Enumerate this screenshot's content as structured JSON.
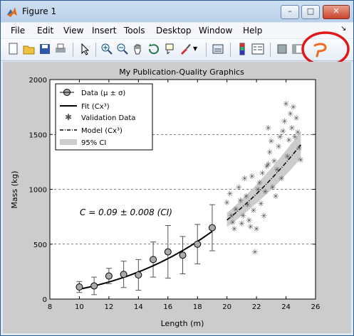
{
  "window": {
    "title": "Figure 1"
  },
  "menu": [
    "File",
    "Edit",
    "View",
    "Insert",
    "Tools",
    "Desktop",
    "Window",
    "Help"
  ],
  "chart_data": {
    "type": "scatter",
    "title": "My Publication-Quality Graphics",
    "xlabel": "Length (m)",
    "ylabel": "Mass (kg)",
    "xlim": [
      8,
      26
    ],
    "ylim": [
      0,
      2000
    ],
    "xticks": [
      8,
      10,
      12,
      14,
      16,
      18,
      20,
      22,
      24,
      26
    ],
    "yticks": [
      0,
      500,
      1000,
      1500,
      2000
    ],
    "grid": "horizontal dashed",
    "legend_position": "top-left",
    "annotation": "C = 0.09 ± 0.008 (CI)",
    "legend": [
      "Data (μ ± σ)",
      "Fit (Cx³)",
      "Validation Data",
      "Model (Cx³)",
      "95% CI"
    ],
    "data": {
      "x": [
        10,
        11,
        12,
        13,
        14,
        15,
        16,
        17,
        18,
        19
      ],
      "y": [
        110,
        120,
        210,
        225,
        220,
        360,
        430,
        400,
        500,
        650
      ],
      "err": [
        50,
        80,
        70,
        120,
        140,
        160,
        240,
        170,
        180,
        210
      ]
    },
    "fit": {
      "x_range": [
        10,
        19
      ],
      "coefficient": 0.09,
      "exponent": 3
    },
    "model": {
      "x_range": [
        20,
        25
      ],
      "coefficient": 0.09,
      "exponent": 3
    },
    "ci_band": {
      "x_range": [
        20,
        25
      ],
      "lower_coefficient": 0.082,
      "upper_coefficient": 0.098
    },
    "validation": [
      [
        20.0,
        880
      ],
      [
        20.2,
        960
      ],
      [
        20.3,
        760
      ],
      [
        20.4,
        700
      ],
      [
        20.5,
        640
      ],
      [
        20.6,
        820
      ],
      [
        20.8,
        1020
      ],
      [
        20.9,
        900
      ],
      [
        21.0,
        690
      ],
      [
        21.1,
        760
      ],
      [
        21.2,
        1100
      ],
      [
        21.3,
        940
      ],
      [
        21.4,
        860
      ],
      [
        21.5,
        720
      ],
      [
        21.6,
        660
      ],
      [
        21.7,
        1120
      ],
      [
        21.8,
        810
      ],
      [
        21.9,
        430
      ],
      [
        22.0,
        640
      ],
      [
        22.1,
        1000
      ],
      [
        22.2,
        1060
      ],
      [
        22.3,
        870
      ],
      [
        22.4,
        1150
      ],
      [
        22.5,
        760
      ],
      [
        22.6,
        980
      ],
      [
        22.7,
        1210
      ],
      [
        22.8,
        1230
      ],
      [
        22.9,
        1340
      ],
      [
        23.0,
        1440
      ],
      [
        23.1,
        1020
      ],
      [
        23.2,
        1260
      ],
      [
        23.3,
        940
      ],
      [
        23.4,
        1180
      ],
      [
        23.5,
        1390
      ],
      [
        23.6,
        1480
      ],
      [
        23.7,
        1100
      ],
      [
        23.8,
        1530
      ],
      [
        23.9,
        1620
      ],
      [
        24.0,
        1780
      ],
      [
        24.1,
        1300
      ],
      [
        24.2,
        1450
      ],
      [
        24.3,
        1690
      ],
      [
        24.4,
        1560
      ],
      [
        24.5,
        1750
      ],
      [
        24.6,
        1480
      ],
      [
        24.7,
        1650
      ],
      [
        24.8,
        1520
      ],
      [
        24.9,
        1380
      ],
      [
        25.0,
        1270
      ],
      [
        22.8,
        1560
      ]
    ]
  }
}
